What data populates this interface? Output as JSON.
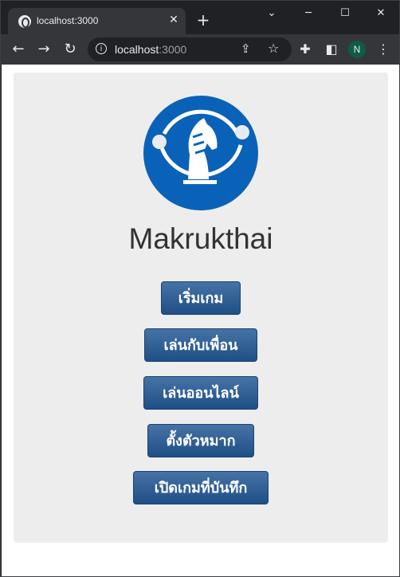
{
  "browser": {
    "tab_title": "localhost:3000",
    "tab_close": "✕",
    "new_tab": "+",
    "window_controls": {
      "minimize": "─",
      "maximize": "☐",
      "close": "✕",
      "tab_search": "⌄"
    },
    "url_host": "localhost",
    "url_port": ":3000",
    "profile_initial": "N",
    "icons": [
      "back-arrow-icon",
      "forward-arrow-icon",
      "reload-icon",
      "info-icon",
      "share-icon",
      "star-icon",
      "extensions-icon",
      "side-panel-icon",
      "menu-icon"
    ]
  },
  "app": {
    "title": "Makrukthai",
    "logo": {
      "icon": "chess-knight-logo-icon",
      "color": "#0a62b8"
    },
    "buttons": [
      {
        "label": "เริ่มเกม"
      },
      {
        "label": "เล่นกับเพื่อน"
      },
      {
        "label": "เล่นออนไลน์"
      },
      {
        "label": "ตั้งตัวหมาก"
      },
      {
        "label": "เปิดเกมที่บันทึก"
      }
    ],
    "button_color": "#2c5f98",
    "card_color": "#ededee"
  }
}
